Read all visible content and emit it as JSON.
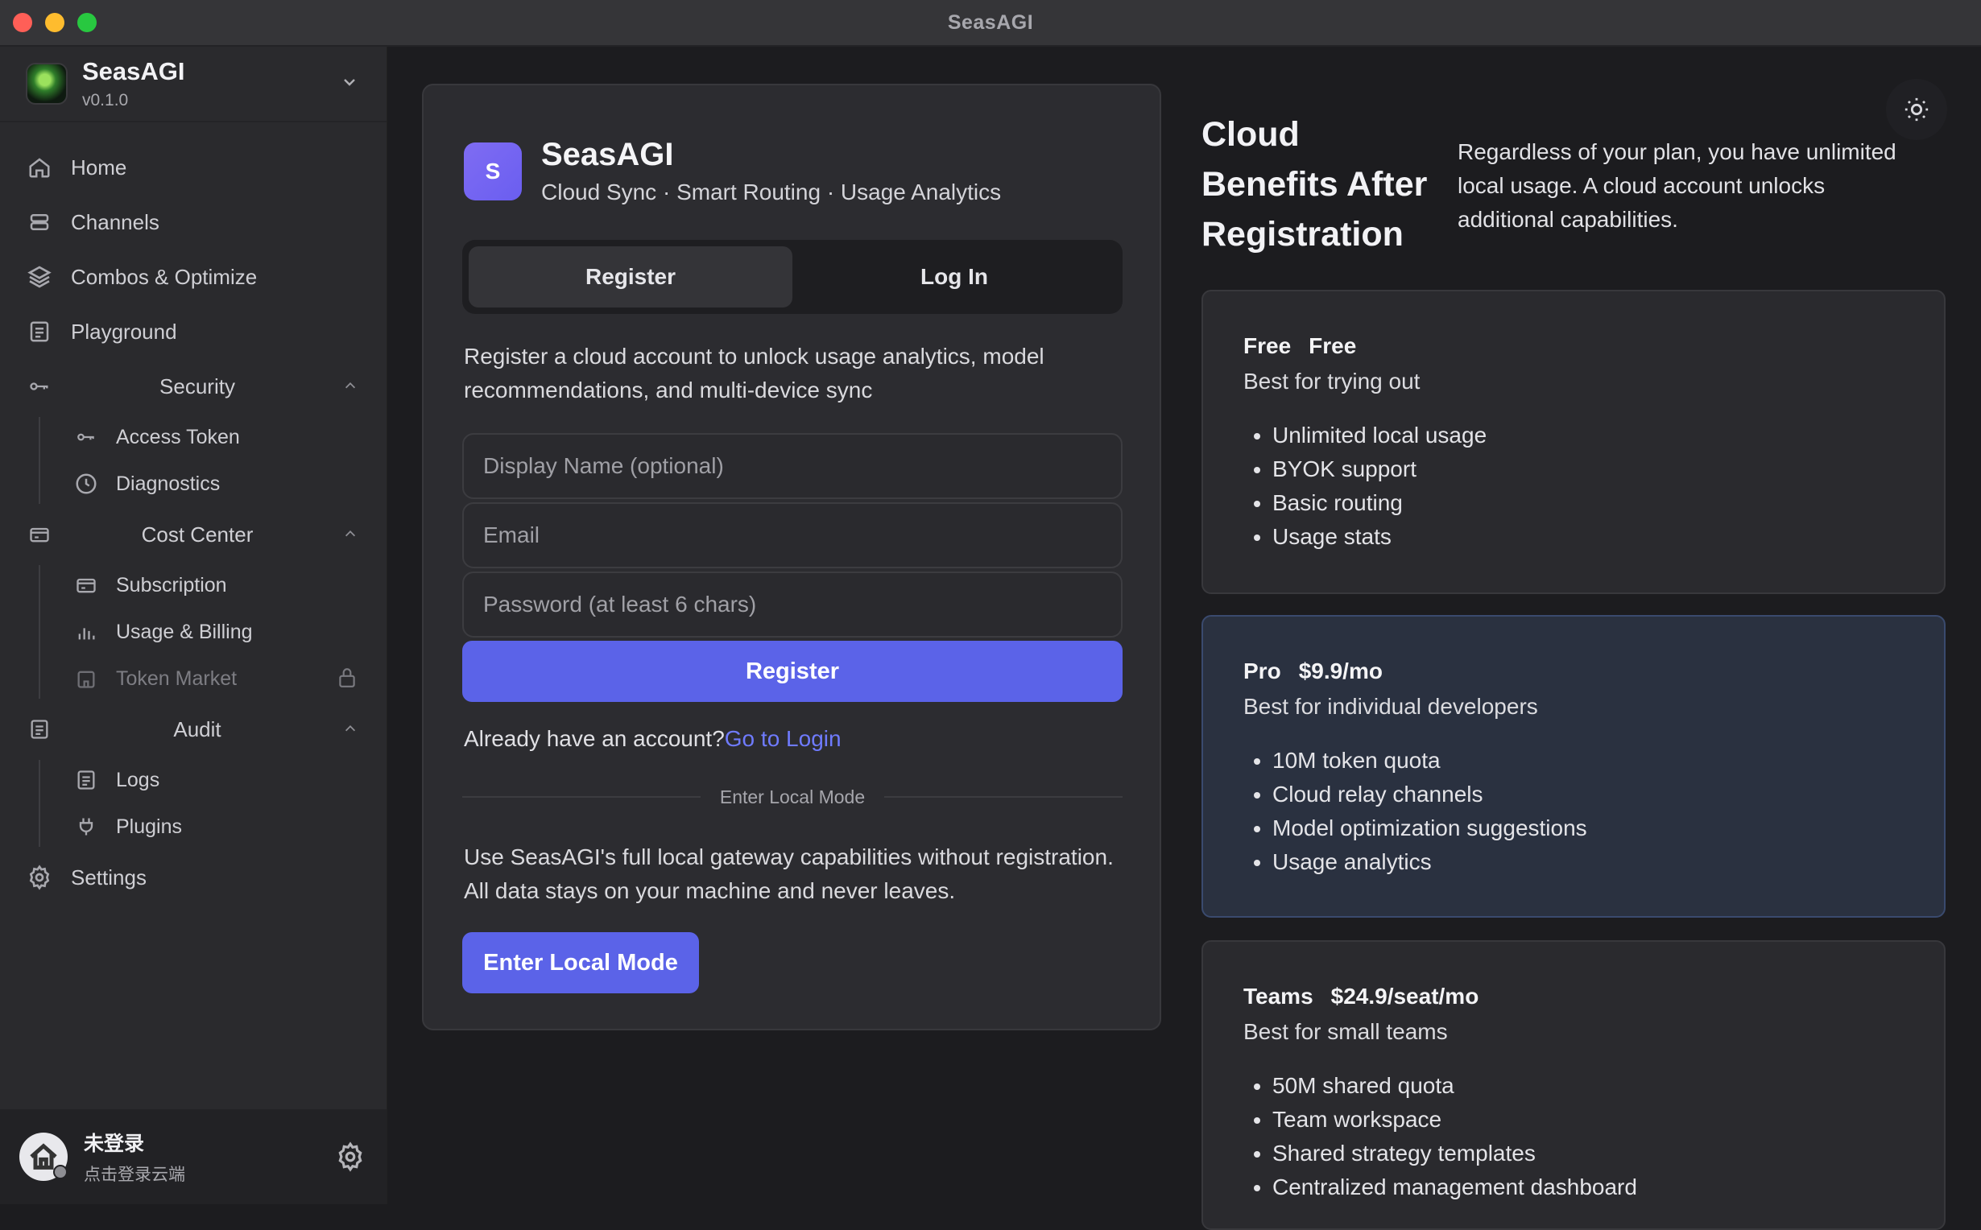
{
  "window": {
    "title": "SeasAGI"
  },
  "sidebar": {
    "brand": {
      "name": "SeasAGI",
      "version": "v0.1.0"
    },
    "items": [
      {
        "label": "Home",
        "icon": "home-icon"
      },
      {
        "label": "Channels",
        "icon": "database-icon"
      },
      {
        "label": "Combos & Optimize",
        "icon": "layers-icon"
      },
      {
        "label": "Playground",
        "icon": "document-icon"
      }
    ],
    "groups": [
      {
        "label": "Security",
        "icon": "key-icon",
        "children": [
          {
            "label": "Access Token",
            "icon": "key-icon"
          },
          {
            "label": "Diagnostics",
            "icon": "clock-icon"
          }
        ]
      },
      {
        "label": "Cost Center",
        "icon": "credit-card-icon",
        "children": [
          {
            "label": "Subscription",
            "icon": "credit-card-icon"
          },
          {
            "label": "Usage & Billing",
            "icon": "bar-chart-icon"
          },
          {
            "label": "Token Market",
            "icon": "store-icon",
            "locked": true
          }
        ]
      },
      {
        "label": "Audit",
        "icon": "document-icon",
        "children": [
          {
            "label": "Logs",
            "icon": "document-icon"
          },
          {
            "label": "Plugins",
            "icon": "plug-icon"
          }
        ]
      }
    ],
    "settings": {
      "label": "Settings",
      "icon": "gear-icon"
    },
    "account": {
      "name": "未登录",
      "subtitle": "点击登录云端"
    }
  },
  "auth_card": {
    "badge_letter": "S",
    "title": "SeasAGI",
    "subtitle": "Cloud Sync · Smart Routing · Usage Analytics",
    "tabs": [
      {
        "label": "Register",
        "active": true
      },
      {
        "label": "Log In",
        "active": false
      }
    ],
    "intro": "Register a cloud account to unlock usage analytics, model recommendations, and multi-device sync",
    "fields": {
      "display_name": {
        "placeholder": "Display Name (optional)",
        "value": ""
      },
      "email": {
        "placeholder": "Email",
        "value": ""
      },
      "password": {
        "placeholder": "Password (at least 6 chars)",
        "value": ""
      }
    },
    "submit_label": "Register",
    "have_account_text": "Already have an account?",
    "go_login_link": "Go to Login",
    "divider_text": "Enter Local Mode",
    "local_desc": "Use SeasAGI's full local gateway capabilities without registration. All data stays on your machine and never leaves.",
    "local_button": "Enter Local Mode"
  },
  "benefits": {
    "title": "Cloud Benefits After Registration",
    "description": "Regardless of your plan, you have unlimited local usage. A cloud account unlocks additional capabilities.",
    "plans": [
      {
        "name": "Free",
        "price": "Free",
        "tagline": "Best for trying out",
        "features": [
          "Unlimited local usage",
          "BYOK support",
          "Basic routing",
          "Usage stats"
        ]
      },
      {
        "name": "Pro",
        "price": "$9.9/mo",
        "tagline": "Best for individual developers",
        "features": [
          "10M token quota",
          "Cloud relay channels",
          "Model optimization suggestions",
          "Usage analytics"
        ]
      },
      {
        "name": "Teams",
        "price": "$24.9/seat/mo",
        "tagline": "Best for small teams",
        "features": [
          "50M shared quota",
          "Team workspace",
          "Shared strategy templates",
          "Centralized management dashboard"
        ]
      }
    ]
  },
  "colors": {
    "accent": "#5b63e8",
    "link": "#6f7bff",
    "highlight_plan_bg": "#2a3140"
  }
}
